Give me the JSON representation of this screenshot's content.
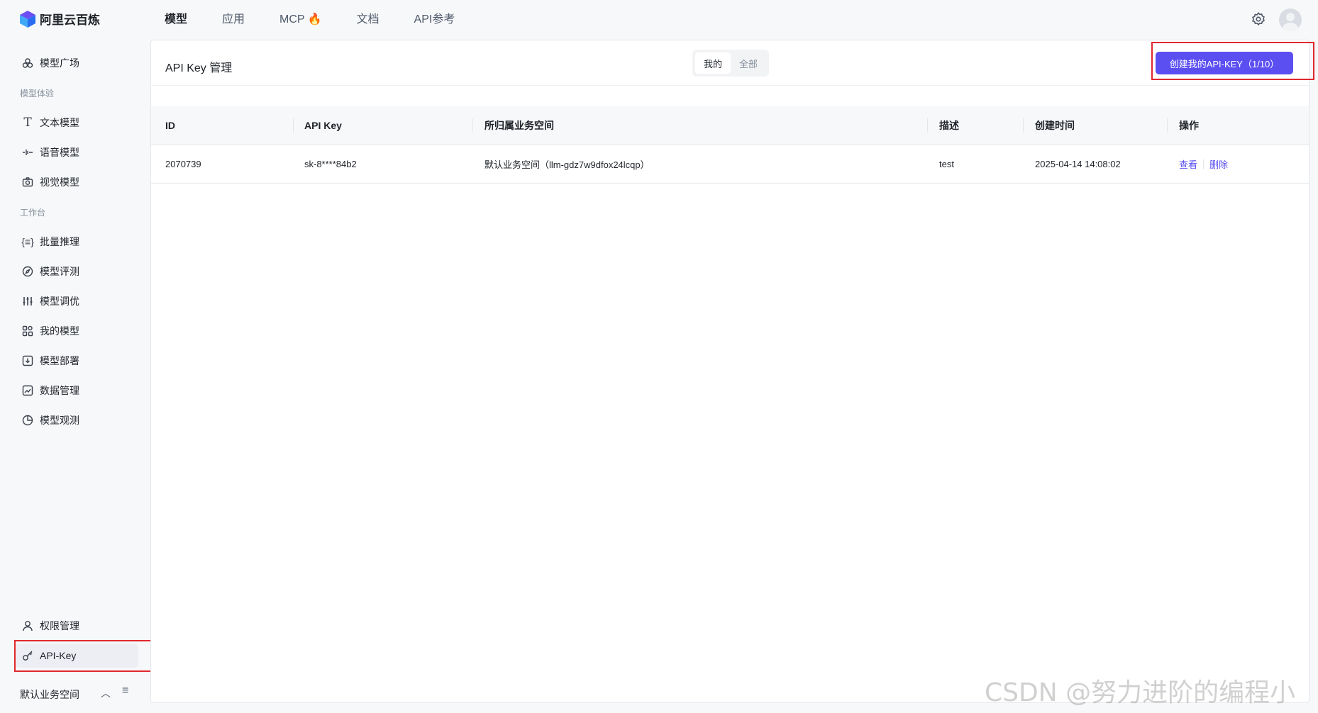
{
  "brand": {
    "name": "阿里云百炼"
  },
  "topnav": [
    {
      "label": "模型",
      "active": true
    },
    {
      "label": "应用",
      "active": false
    },
    {
      "label": "MCP",
      "active": false
    },
    {
      "label": "文档",
      "active": false
    },
    {
      "label": "API参考",
      "active": false
    }
  ],
  "sidebar": {
    "model_square": "模型广场",
    "group_experience": "模型体验",
    "text_model": "文本模型",
    "voice_model": "语音模型",
    "vision_model": "视觉模型",
    "group_workbench": "工作台",
    "batch_inference": "批量推理",
    "model_eval": "模型评测",
    "model_tune": "模型调优",
    "my_models": "我的模型",
    "model_deploy": "模型部署",
    "data_manage": "数据管理",
    "model_observe": "模型观测",
    "permission": "权限管理",
    "api_key": "API-Key",
    "workspace": "默认业务空间"
  },
  "main": {
    "title": "API Key 管理",
    "seg_mine": "我的",
    "seg_all": "全部",
    "create_button": "创建我的API-KEY（1/10）",
    "columns": {
      "id": "ID",
      "api_key": "API Key",
      "workspace": "所归属业务空间",
      "desc": "描述",
      "created": "创建时间",
      "ops": "操作"
    },
    "rows": [
      {
        "id": "2070739",
        "api_key": "sk-8****84b2",
        "workspace": "默认业务空间（llm-gdz7w9dfox24lcqp）",
        "desc": "test",
        "created": "2025-04-14 14:08:02",
        "view": "查看",
        "delete": "删除"
      }
    ]
  },
  "watermark": "CSDN @努力进阶的编程小白",
  "colors": {
    "accent": "#5b4ff2",
    "highlight": "#e0282e"
  }
}
